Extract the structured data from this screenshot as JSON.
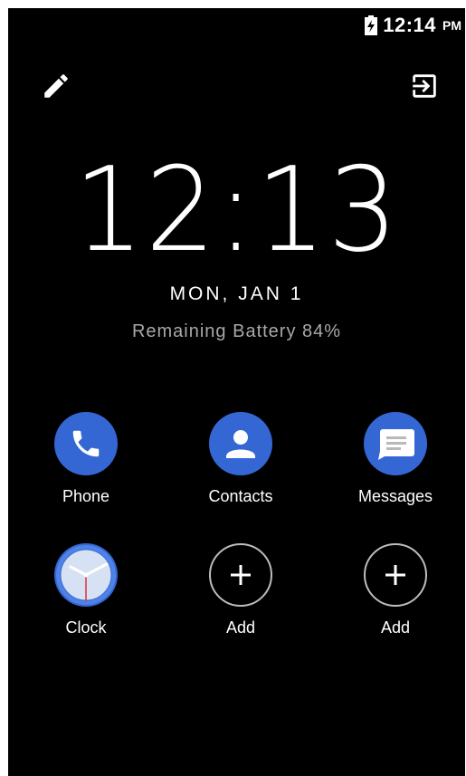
{
  "status_bar": {
    "time": "12:14",
    "ampm": "PM",
    "battery_icon": "battery-charging-icon"
  },
  "toolbar": {
    "edit_icon": "pencil-icon",
    "exit_icon": "exit-icon"
  },
  "clock": {
    "time": "12:13",
    "date": "MON, JAN 1",
    "battery_text": "Remaining Battery 84%"
  },
  "apps": [
    {
      "label": "Phone",
      "icon": "phone-icon"
    },
    {
      "label": "Contacts",
      "icon": "contacts-icon"
    },
    {
      "label": "Messages",
      "icon": "messages-icon"
    },
    {
      "label": "Clock",
      "icon": "clock-icon"
    },
    {
      "label": "Add",
      "icon": "add-icon"
    },
    {
      "label": "Add",
      "icon": "add-icon"
    }
  ],
  "colors": {
    "background": "#000000",
    "app_blue": "#3567d4",
    "secondary_text": "#a8a8a8"
  }
}
